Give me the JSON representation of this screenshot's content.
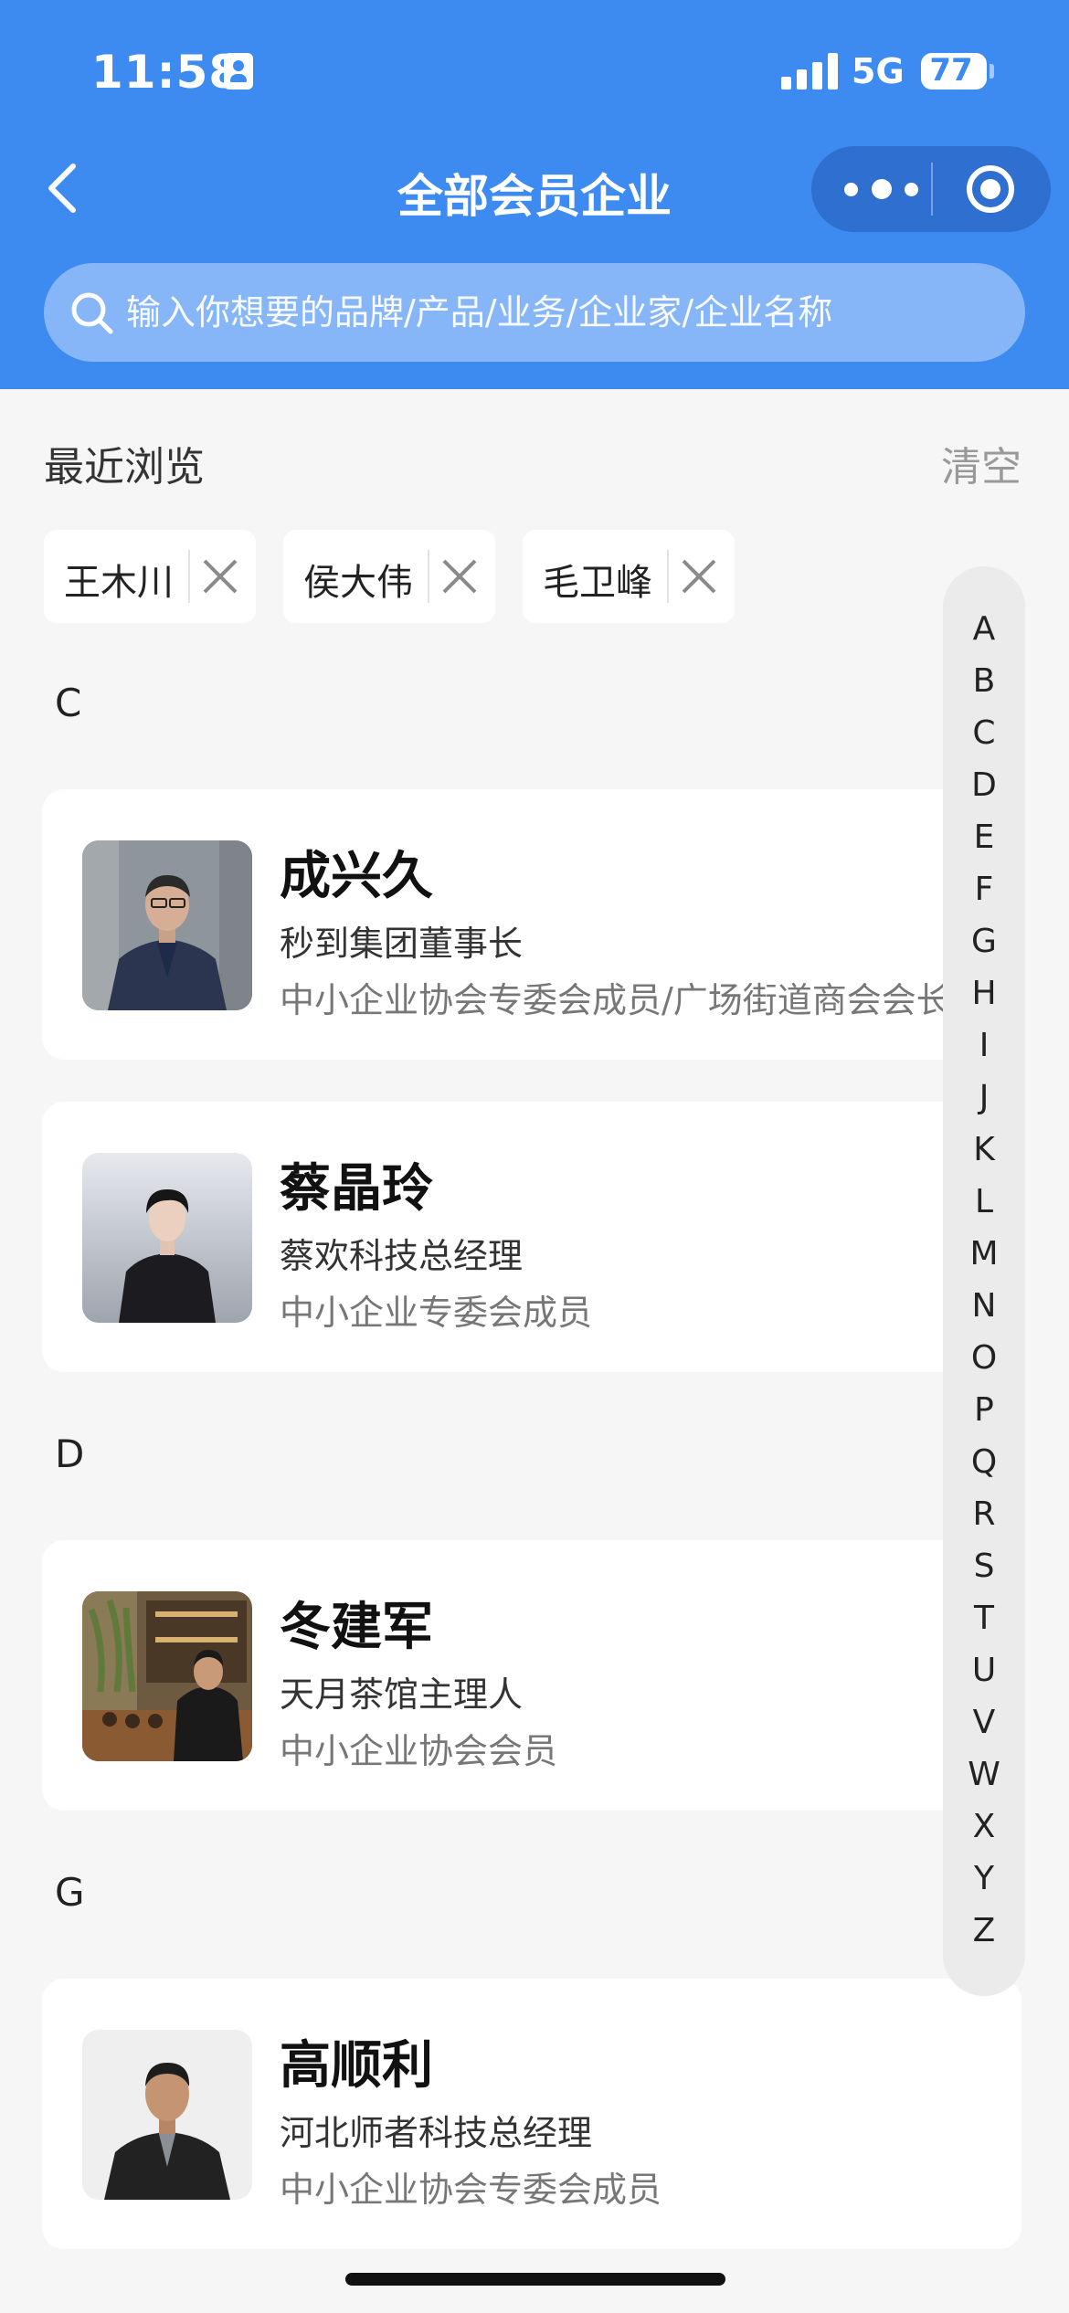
{
  "status_bar": {
    "time": "11:58",
    "network": "5G",
    "battery": "77"
  },
  "header": {
    "title": "全部会员企业"
  },
  "search": {
    "placeholder": "输入你想要的品牌/产品/业务/企业家/企业名称"
  },
  "recent": {
    "title": "最近浏览",
    "clear_label": "清空",
    "chips": [
      {
        "label": "王木川"
      },
      {
        "label": "侯大伟"
      },
      {
        "label": "毛卫峰"
      }
    ]
  },
  "sections": [
    {
      "letter": "C",
      "members": [
        {
          "name": "成兴久",
          "company": "秒到集团董事长",
          "roles": "中小企业协会专委会成员/广场街道商会会长"
        },
        {
          "name": "蔡晶玲",
          "company": "蔡欢科技总经理",
          "roles": "中小企业专委会成员"
        }
      ]
    },
    {
      "letter": "D",
      "members": [
        {
          "name": "冬建军",
          "company": "天月茶馆主理人",
          "roles": "中小企业协会会员"
        }
      ]
    },
    {
      "letter": "G",
      "members": [
        {
          "name": "高顺利",
          "company": "河北师者科技总经理",
          "roles": "中小企业协会专委会成员"
        }
      ]
    }
  ],
  "index_letters": [
    "A",
    "B",
    "C",
    "D",
    "E",
    "F",
    "G",
    "H",
    "I",
    "J",
    "K",
    "L",
    "M",
    "N",
    "O",
    "P",
    "Q",
    "R",
    "S",
    "T",
    "U",
    "V",
    "W",
    "X",
    "Y",
    "Z"
  ],
  "colors": {
    "header_bg": "#3d8bf0",
    "search_bg": "#86b6f7",
    "page_bg": "#f6f6f6"
  }
}
